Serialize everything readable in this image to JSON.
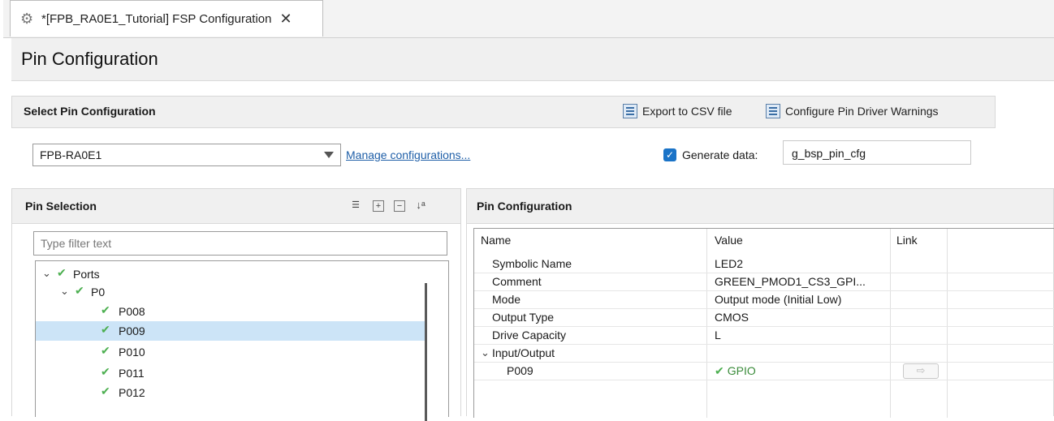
{
  "tab": {
    "title": "*[FPB_RA0E1_Tutorial] FSP Configuration",
    "close": "✕"
  },
  "page_title": "Pin Configuration",
  "select_section": {
    "label": "Select Pin Configuration",
    "export_label": "Export to CSV file",
    "warnings_label": "Configure Pin Driver Warnings",
    "config_value": "FPB-RA0E1",
    "manage_link": "Manage configurations...",
    "generate_label": "Generate data:",
    "generate_checked": true,
    "generate_value": "g_bsp_pin_cfg"
  },
  "pin_selection": {
    "label": "Pin Selection",
    "filter_placeholder": "Type filter text",
    "tree": [
      {
        "label": "Ports",
        "level": 0,
        "expanded": true,
        "checked": true
      },
      {
        "label": "P0",
        "level": 1,
        "expanded": true,
        "checked": true
      },
      {
        "label": "P008",
        "level": 2,
        "checked": true
      },
      {
        "label": "P009",
        "level": 2,
        "checked": true,
        "selected": true
      },
      {
        "label": "P010",
        "level": 2,
        "checked": true
      },
      {
        "label": "P011",
        "level": 2,
        "checked": true
      },
      {
        "label": "P012",
        "level": 2,
        "checked": true
      }
    ]
  },
  "pin_config": {
    "label": "Pin Configuration",
    "columns": {
      "name": "Name",
      "value": "Value",
      "link": "Link"
    },
    "rows": [
      {
        "name": "Symbolic Name",
        "value": "LED2"
      },
      {
        "name": "Comment",
        "value": "GREEN_PMOD1_CS3_GPI..."
      },
      {
        "name": "Mode",
        "value": "Output mode (Initial Low)"
      },
      {
        "name": "Output Type",
        "value": "CMOS"
      },
      {
        "name": "Drive Capacity",
        "value": "L"
      },
      {
        "name": "Input/Output",
        "value": ""
      },
      {
        "name": "P009",
        "value": "GPIO"
      }
    ]
  }
}
